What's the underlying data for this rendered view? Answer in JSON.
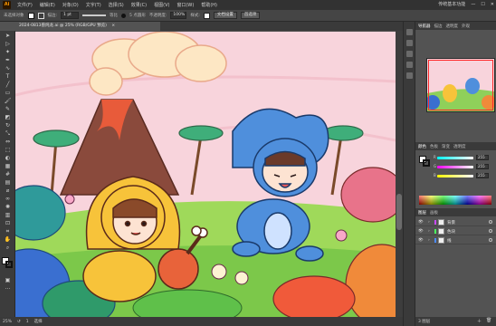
{
  "menu": {
    "logo": "Ai",
    "items": [
      "文件(F)",
      "编辑(E)",
      "对象(O)",
      "文字(T)",
      "选择(S)",
      "效果(C)",
      "视图(V)",
      "窗口(W)",
      "帮助(H)"
    ],
    "workspace": "传统基本功能"
  },
  "control_bar": {
    "selection_label": "未选择对象",
    "stroke_label": "描边:",
    "stroke_value": "1 pt",
    "profile_label": "等比",
    "brush_label": "5 点圆形",
    "opacity_label": "不透明度:",
    "opacity_value": "100%",
    "style_label": "样式:",
    "doc_setup_button": "文档设置",
    "prefs_button": "首选项"
  },
  "document": {
    "tab_title": "2024-0813兽炖龙.ai @ 25% (RGB/GPU 预览)",
    "close_glyph": "×"
  },
  "status_bar": {
    "zoom": "25%",
    "page": "1",
    "tool": "选择"
  },
  "navigator": {
    "tabs": [
      "导航器",
      "描边",
      "透明度",
      "外观"
    ],
    "active": "导航器"
  },
  "color_panel": {
    "tabs": [
      "颜色",
      "色板",
      "渐变",
      "透明度"
    ],
    "channels": [
      {
        "name": "R",
        "value": "255",
        "color": "#ff5e5e"
      },
      {
        "name": "G",
        "value": "255",
        "color": "#5eff7a"
      },
      {
        "name": "B",
        "value": "255",
        "color": "#5e8bff"
      }
    ]
  },
  "layers_panel": {
    "tabs": [
      "图层",
      "画板"
    ],
    "layers": [
      {
        "name": "背景",
        "color": "#c94bff"
      },
      {
        "name": "色块",
        "color": "#4bff5f"
      },
      {
        "name": "线",
        "color": "#4b8bff"
      }
    ],
    "layer_count": "3 图层"
  },
  "colors": {
    "accent_orange": "#ff9a00",
    "app_dark": "#323232",
    "panel_gray": "#535353"
  }
}
